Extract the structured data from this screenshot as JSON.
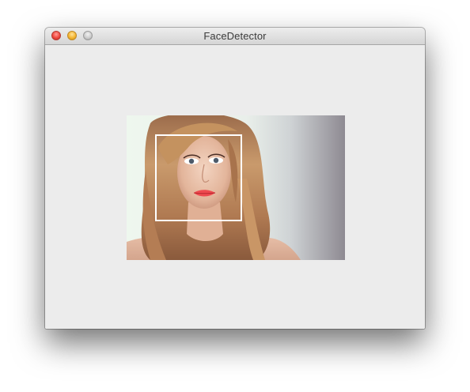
{
  "window": {
    "title": "FaceDetector"
  },
  "titlebar": {
    "buttons": [
      {
        "name": "close",
        "color": "#f0473e"
      },
      {
        "name": "minimize",
        "color": "#f5b631"
      },
      {
        "name": "zoom",
        "color": "#c9c9c9"
      }
    ]
  },
  "image": {
    "subject": "portrait-photo",
    "detections": [
      {
        "label": "face",
        "box_color": "#ffffff"
      }
    ]
  },
  "colors": {
    "window_background": "#ececec",
    "detection_box": "#ffffff"
  }
}
